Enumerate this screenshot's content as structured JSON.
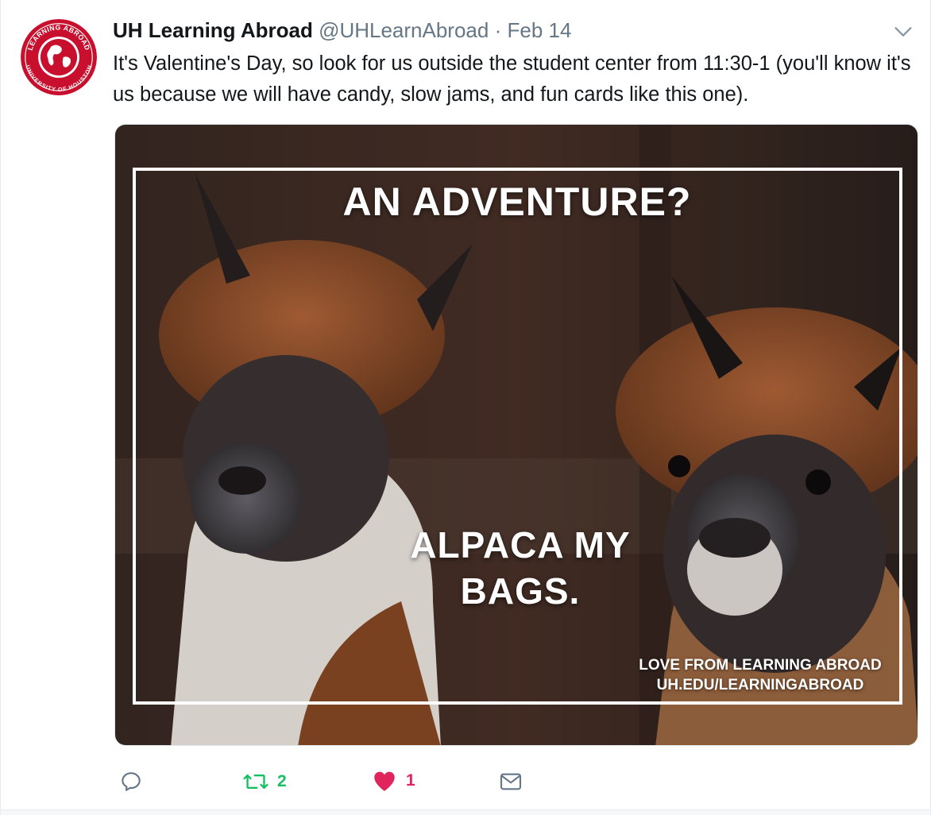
{
  "tweet": {
    "display_name": "UH Learning Abroad",
    "handle": "@UHLearnAbroad",
    "separator": "·",
    "date": "Feb 14",
    "text": "It's Valentine's Day, so look for us outside the student center from 11:30-1 (you'll know it's us because we will have candy, slow jams, and fun cards like this one)."
  },
  "avatar": {
    "ring_top": "LEARNING ABROAD",
    "ring_bottom": "UNIVERSITY OF HOUSTON",
    "color": "#c8102e"
  },
  "media": {
    "title": "AN ADVENTURE?",
    "punchline_line1": "ALPACA MY",
    "punchline_line2": "BAGS.",
    "credit_line1": "LOVE FROM LEARNING ABROAD",
    "credit_line2": "UH.EDU/LEARNINGABROAD"
  },
  "actions": {
    "reply_icon": "reply-icon",
    "retweet_icon": "retweet-icon",
    "retweet_count": "2",
    "like_icon": "heart-icon",
    "like_count": "1",
    "dm_icon": "envelope-icon"
  },
  "colors": {
    "text": "#14171a",
    "muted": "#657786",
    "retweet": "#17bf63",
    "like": "#e0245e"
  }
}
